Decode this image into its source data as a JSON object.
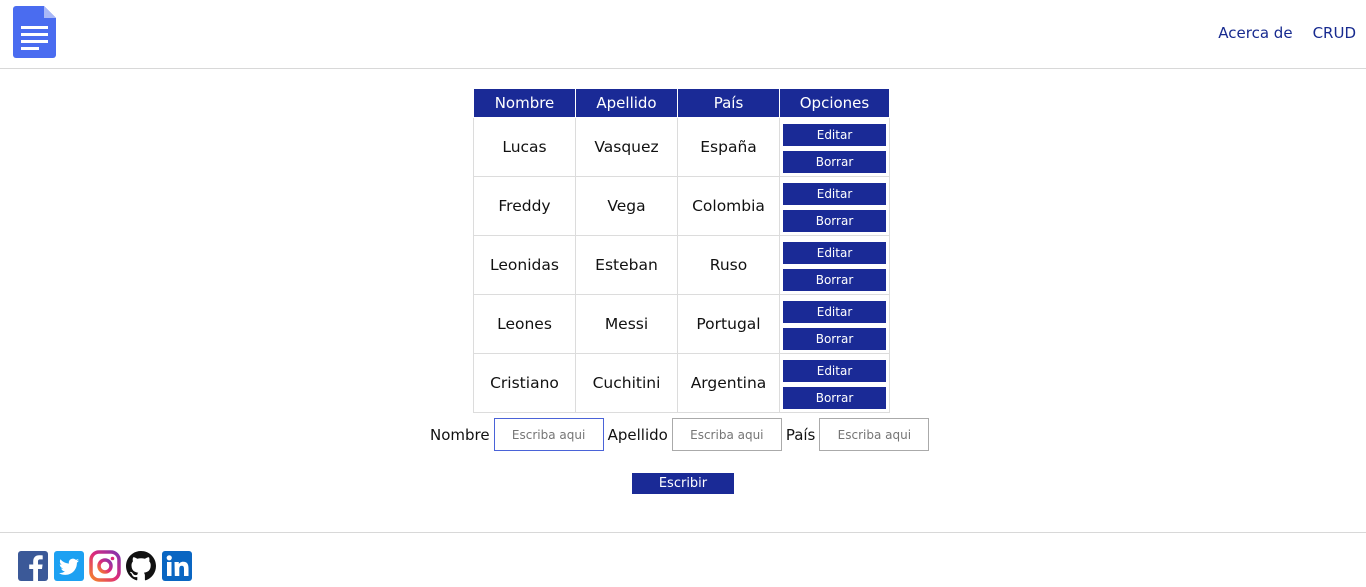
{
  "header": {
    "nav": [
      "Acerca de",
      "CRUD"
    ]
  },
  "table": {
    "headers": [
      "Nombre",
      "Apellido",
      "País",
      "Opciones"
    ],
    "rows": [
      {
        "nombre": "Lucas",
        "apellido": "Vasquez",
        "pais": "España"
      },
      {
        "nombre": "Freddy",
        "apellido": "Vega",
        "pais": "Colombia"
      },
      {
        "nombre": "Leonidas",
        "apellido": "Esteban",
        "pais": "Ruso"
      },
      {
        "nombre": "Leones",
        "apellido": "Messi",
        "pais": "Portugal"
      },
      {
        "nombre": "Cristiano",
        "apellido": "Cuchitini",
        "pais": "Argentina"
      }
    ],
    "edit_label": "Editar",
    "delete_label": "Borrar"
  },
  "form": {
    "nombre_label": "Nombre",
    "apellido_label": "Apellido",
    "pais_label": "País",
    "placeholder": "Escriba aqui",
    "submit_label": "Escribir"
  },
  "footer": {
    "social": [
      "facebook-icon",
      "twitter-icon",
      "instagram-icon",
      "github-icon",
      "linkedin-icon"
    ]
  },
  "colors": {
    "primary": "#1a2a96",
    "link": "#172a8f"
  }
}
